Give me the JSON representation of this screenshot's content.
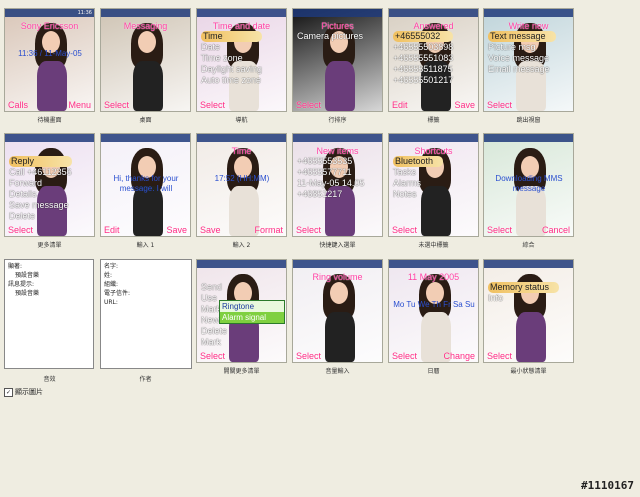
{
  "tiles": [
    {
      "title": "Sony Ericsson",
      "items": [],
      "left": "Calls",
      "right": "Menu",
      "caption": "待機畫面",
      "clock": "11:36",
      "text": "11:36 / 11-May-05",
      "bg": "#d9c6b8"
    },
    {
      "title": "Messaging",
      "items": [],
      "left": "Select",
      "right": "",
      "caption": "桌面",
      "clock": "",
      "text": "",
      "bg": "#cfc4b4"
    },
    {
      "title": "Time and date",
      "items": [
        "Time",
        "Date",
        "Time zone",
        "Daylight saving",
        "Auto time zone"
      ],
      "selected": 0,
      "left": "Select",
      "right": "",
      "caption": "導航",
      "clock": "",
      "text": "",
      "bg": "#e9d5e6"
    },
    {
      "title": "Pictures",
      "items": [
        "Camera pictures"
      ],
      "selected": -1,
      "left": "Select",
      "right": "",
      "caption": "行排序",
      "clock": "",
      "text": "",
      "bg": "#111111"
    },
    {
      "title": "Answered",
      "items": [
        "+46555032",
        "+46555503898",
        "+46555551083",
        "+46555511875",
        "+46555501217"
      ],
      "selected": 0,
      "left": "Edit",
      "right": "Save",
      "caption": "標籤",
      "clock": "",
      "text": "",
      "bg": "#d8cfc2"
    },
    {
      "title": "Write new",
      "items": [
        "Text message",
        "Picture msg",
        "Voice message",
        "Email message"
      ],
      "selected": 0,
      "left": "Select",
      "right": "",
      "caption": "跳出視窗",
      "clock": "",
      "text": "",
      "bg": "#bfd4da"
    },
    {
      "title": "",
      "items": [
        "Reply",
        "Call +46112356",
        "Forward",
        "Details",
        "Save message",
        "Delete"
      ],
      "selected": 0,
      "left": "Select",
      "right": "",
      "caption": "更多清單",
      "clock": "",
      "text": "",
      "bg": "#ecdff0"
    },
    {
      "title": "",
      "items": [],
      "left": "Edit",
      "right": "Save",
      "caption": "輸入 1",
      "clock": "",
      "text": "Hi, thanks for your message. I will",
      "bg": "#f4f0f8"
    },
    {
      "title": "Time",
      "items": [],
      "left": "Save",
      "right": "Format",
      "caption": "輸入 2",
      "clock": "",
      "text": "17:52 (HH:MM)",
      "bg": "#f1ebe6"
    },
    {
      "title": "New items",
      "items": [
        "+4655553535",
        "+4655577711",
        "11-May-05  14.05",
        "+46851217"
      ],
      "selected": -1,
      "left": "Select",
      "right": "",
      "caption": "快捷鍵入選單",
      "clock": "",
      "text": "",
      "bg": "#eadfe8"
    },
    {
      "title": "Shortcuts",
      "items": [
        "Bluetooth",
        "Tasks",
        "Alarms",
        "Notes"
      ],
      "selected": 0,
      "left": "Select",
      "right": "",
      "caption": "未選中標籤",
      "clock": "",
      "text": "",
      "bg": "#efe5ef"
    },
    {
      "title": "",
      "items": [],
      "left": "Select",
      "right": "Cancel",
      "caption": "綜合",
      "clock": "",
      "text": "Downloading MMS message",
      "bg": "#d7e7d8"
    },
    {
      "title": "",
      "items": [
        "Send",
        "Use",
        "Mark",
        "New",
        "Delete",
        "Mark"
      ],
      "selected": -1,
      "left": "Select",
      "right": "",
      "caption": "開關更多清單",
      "clock": "",
      "text": "",
      "bg": "#efe4ea",
      "popup": [
        "Ringtone",
        "Alarm signal"
      ]
    },
    {
      "title": "Ring volume",
      "items": [],
      "left": "Select",
      "right": "",
      "caption": "音量輸入",
      "clock": "",
      "text": "",
      "bg": "#f1eef2"
    },
    {
      "title": "11 May 2005",
      "items": [],
      "left": "Select",
      "right": "Change",
      "caption": "日曆",
      "clock": "",
      "text": "Mo Tu We Th Fr Sa Su",
      "bg": "#eee6ef"
    },
    {
      "title": "",
      "items": [
        "Memory status",
        "Info"
      ],
      "selected": 0,
      "left": "Select",
      "right": "",
      "caption": "最小狀態清單",
      "clock": "",
      "text": "",
      "bg": "#f3ede6"
    }
  ],
  "panel1": {
    "lines": [
      "顯著:",
      "預設音樂",
      "訊息提示:",
      "預設音樂"
    ],
    "caption": "音效"
  },
  "panel2": {
    "lines": [
      "名字:",
      "",
      "姓:",
      "",
      "組織:",
      "",
      "電子信件:",
      "",
      "URL:"
    ],
    "caption": "作者"
  },
  "checkbox": {
    "label": "顯示圖片",
    "checked": "✓"
  },
  "watermark": "#1110167",
  "colors": {
    "softkey": "#ff2c85",
    "title": "#ff3fa3",
    "status": "#1e3a7a"
  }
}
